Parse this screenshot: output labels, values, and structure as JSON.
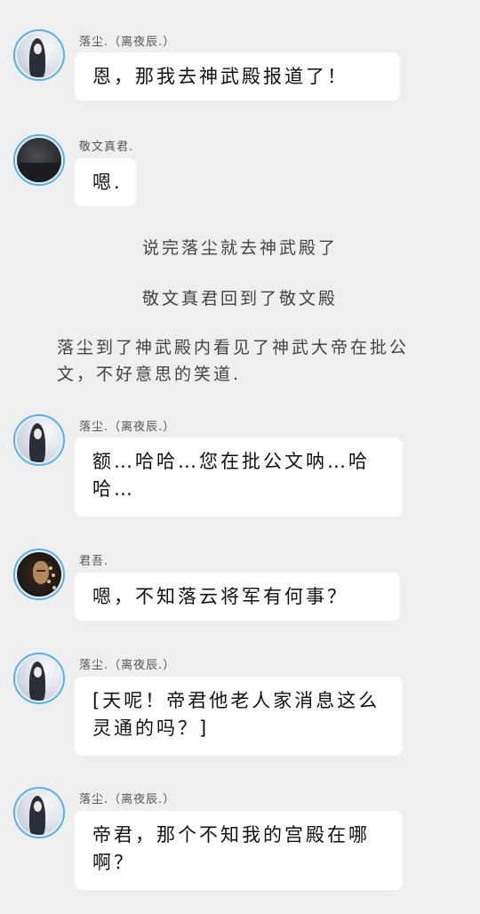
{
  "messages": [
    {
      "sender": "落尘.（离夜辰.）",
      "text": "恩，那我去神武殿报道了！"
    },
    {
      "sender": "敬文真君.",
      "text": "嗯."
    },
    {
      "sender": "落尘.（离夜辰.）",
      "text": "额…哈哈…您在批公文呐…哈哈…"
    },
    {
      "sender": "君吾.",
      "text": "嗯，不知落云将军有何事？"
    },
    {
      "sender": "落尘.（离夜辰.）",
      "text": "[天呢！帝君他老人家消息这么灵通的吗？]"
    },
    {
      "sender": "落尘.（离夜辰.）",
      "text": "帝君，那个不知我的宫殿在哪啊？"
    }
  ],
  "narration": [
    "说完落尘就去神武殿了",
    "敬文真君回到了敬文殿",
    "落尘到了神武殿内看见了神武大帝在批公文，不好意思的笑道."
  ],
  "theme": {
    "background": "#efefef",
    "bubble": "#ffffff",
    "avatar_ring": "#4fb3f0"
  }
}
